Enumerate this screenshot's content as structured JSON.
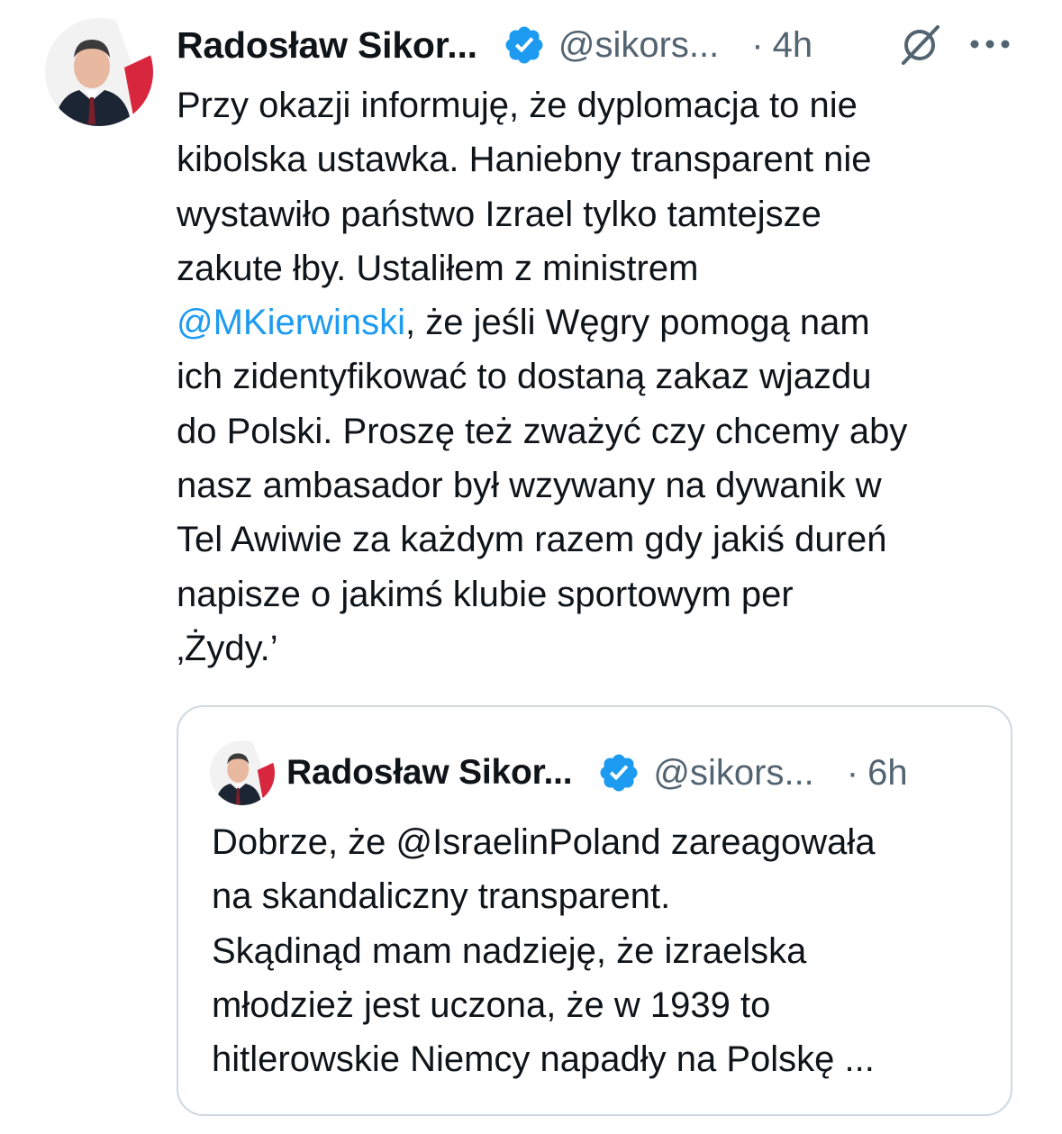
{
  "tweet": {
    "author": {
      "display_name": "Radosław Sikor...",
      "handle": "@sikors...",
      "verified": true
    },
    "separator": "·",
    "time": "4h",
    "icons": {
      "grok": "grok-icon",
      "more": "more-options-icon"
    },
    "text_lines": [
      "Przy okazji informuję, że dyplomacja to nie",
      "kibolska ustawka. Haniebny transparent nie",
      "wystawiło państwo Izrael tylko tamtejsze",
      "zakute łby. Ustaliłem  z ministrem",
      "",
      "ich zidentyfikować to dostaną zakaz wjazdu",
      "do Polski.  Proszę też zważyć czy chcemy aby",
      "nasz ambasador był wzywany na dywanik w",
      "Tel Awiwie za każdym razem gdy jakiś dureń",
      "napisze o jakimś klubie sportowym per",
      "‚Żydy.’"
    ],
    "mention_line": {
      "mention": "@MKierwinski",
      "rest": ", że jeśli Węgry pomogą nam"
    },
    "accent_color": "#1d9bf0",
    "verified_color": "#1d9bf0"
  },
  "quoted_tweet": {
    "author": {
      "display_name": "Radosław Sikor...",
      "handle": "@sikors...",
      "verified": true
    },
    "separator": "·",
    "time": "6h",
    "text_lines": [
      "Dobrze, że @IsraelinPoland zareagowała",
      "na skandaliczny transparent.",
      "Skądinąd mam nadzieję, że izraelska",
      "młodzież jest uczona, że w 1939 to",
      "hitlerowskie Niemcy napadły na Polskę ..."
    ]
  }
}
